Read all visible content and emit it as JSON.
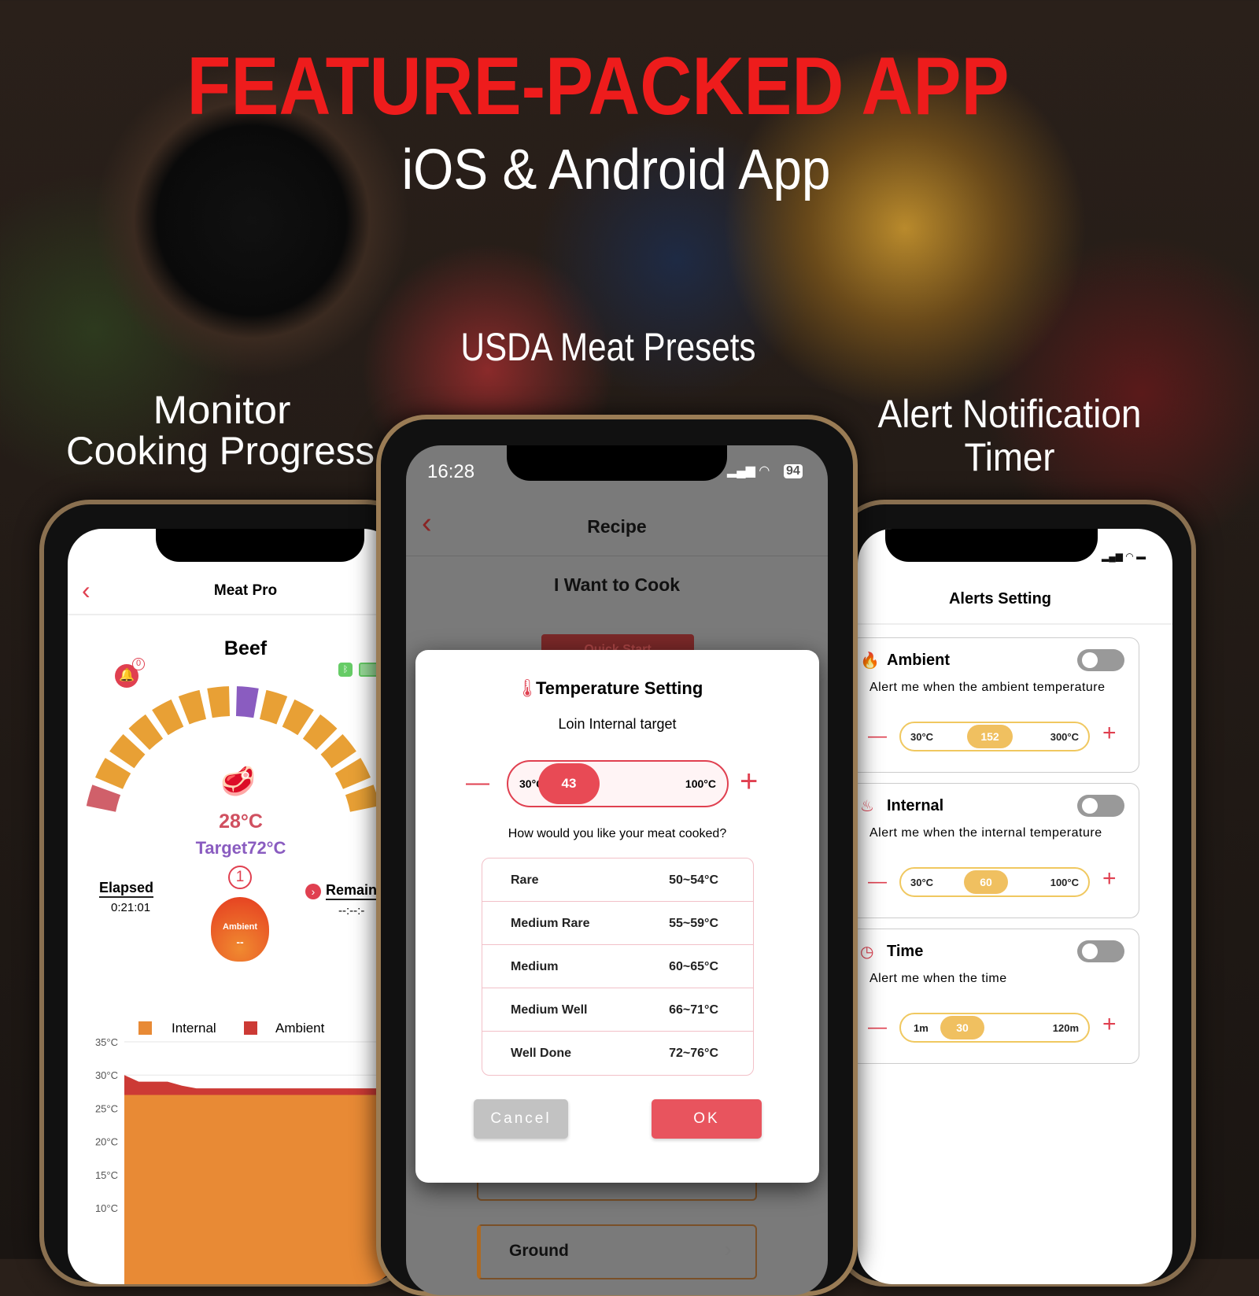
{
  "headline": {
    "title": "FEATURE-PACKED APP",
    "subtitle": "iOS & Android App",
    "title_color": "#ee1c1c"
  },
  "features": {
    "center": "USDA Meat Presets",
    "left_line1": "Monitor",
    "left_line2": "Cooking Progress",
    "right_line1": "Alert Notification",
    "right_line2": "Timer"
  },
  "left_phone": {
    "nav_title": "Meat Pro",
    "meat": "Beef",
    "bell_badge": "0",
    "current_temp": "28°C",
    "target": "Target72°C",
    "probe_number": "1",
    "elapsed_label": "Elapsed",
    "elapsed_value": "0:21:01",
    "remaining_label": "Remain",
    "remaining_value": "--:--:-",
    "ambient_label": "Ambient",
    "ambient_value": "--",
    "icons": [
      "back-chevron-icon",
      "bell-icon",
      "bluetooth-icon",
      "battery-icon",
      "steak-icon",
      "flame-icon"
    ],
    "colors": {
      "gauge": "#e8a035",
      "gauge_current": "#8a5cc0",
      "gauge_low": "#d0606a",
      "accent": "#e04050"
    }
  },
  "chart_data": {
    "type": "area",
    "legend": [
      "Internal",
      "Ambient"
    ],
    "legend_placement": "top",
    "yticks": [
      "35°C",
      "30°C",
      "25°C",
      "20°C",
      "15°C",
      "10°C"
    ],
    "ylim": [
      10,
      35
    ],
    "grid": true,
    "series": [
      {
        "name": "Internal",
        "color": "#e88a35",
        "values": [
          27,
          27,
          27,
          27,
          27,
          27,
          27,
          27,
          27,
          27,
          27,
          27,
          27,
          27,
          27,
          27,
          27,
          27,
          27,
          27
        ]
      },
      {
        "name": "Ambient",
        "color": "#cc3a35",
        "values": [
          30,
          29,
          29,
          29,
          28.4,
          28,
          28,
          28,
          28,
          28,
          28,
          28,
          28,
          28,
          28,
          28,
          28,
          28,
          28,
          28
        ]
      }
    ]
  },
  "middle_phone": {
    "time": "16:28",
    "battery": "94",
    "nav_title": "Recipe",
    "section": "I Want to Cook",
    "quick_start": "Quick Start",
    "list_item": "Ground",
    "modal": {
      "title": "Temperature Setting",
      "subtitle": "Loin Internal target",
      "min": "30°C",
      "value": "43",
      "max": "100°C",
      "question": "How would you like your meat cooked?",
      "doneness": [
        {
          "name": "Rare",
          "range": "50~54°C"
        },
        {
          "name": "Medium Rare",
          "range": "55~59°C"
        },
        {
          "name": "Medium",
          "range": "60~65°C"
        },
        {
          "name": "Medium Well",
          "range": "66~71°C"
        },
        {
          "name": "Well Done",
          "range": "72~76°C"
        }
      ],
      "cancel": "Cancel",
      "ok": "OK"
    }
  },
  "right_phone": {
    "nav_title": "Alerts Setting",
    "alerts": [
      {
        "title": "Ambient",
        "desc": "Alert me when the ambient temperature",
        "min": "30°C",
        "value": "152",
        "max": "300°C",
        "enabled": false
      },
      {
        "title": "Internal",
        "desc": "Alert me when the internal temperature",
        "min": "30°C",
        "value": "60",
        "max": "100°C",
        "enabled": false
      },
      {
        "title": "Time",
        "desc": "Alert me when the time",
        "min": "1m",
        "value": "30",
        "max": "120m",
        "enabled": false
      }
    ]
  }
}
